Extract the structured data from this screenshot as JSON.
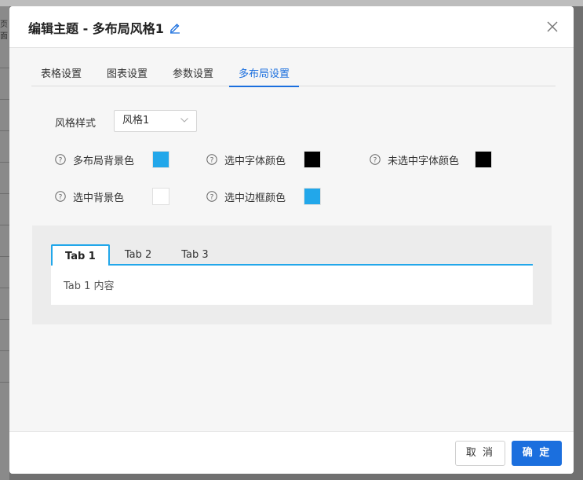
{
  "background": {
    "left_text": "页面"
  },
  "dialog": {
    "title": "编辑主题 - 多布局风格1",
    "close_icon": "close-icon",
    "edit_icon": "pencil-icon"
  },
  "tabs": [
    {
      "label": "表格设置",
      "active": false
    },
    {
      "label": "图表设置",
      "active": false
    },
    {
      "label": "参数设置",
      "active": false
    },
    {
      "label": "多布局设置",
      "active": true
    }
  ],
  "style_select": {
    "label": "风格样式",
    "value": "风格1"
  },
  "colors": {
    "layout_bg": {
      "label": "多布局背景色",
      "color": "#22a7ea"
    },
    "selected_font": {
      "label": "选中字体颜色",
      "color": "#000000"
    },
    "unselected_font": {
      "label": "未选中字体颜色",
      "color": "#000000"
    },
    "selected_bg": {
      "label": "选中背景色",
      "color": "#ffffff"
    },
    "selected_border": {
      "label": "选中边框颜色",
      "color": "#22a7ea"
    }
  },
  "preview": {
    "tabs": [
      {
        "label": "Tab 1",
        "active": true
      },
      {
        "label": "Tab 2",
        "active": false
      },
      {
        "label": "Tab 3",
        "active": false
      }
    ],
    "content": "Tab 1 内容"
  },
  "footer": {
    "cancel_label": "取 消",
    "ok_label": "确 定"
  },
  "theme": {
    "accent": "#1b6fde",
    "preview_accent": "#22a7ea"
  }
}
